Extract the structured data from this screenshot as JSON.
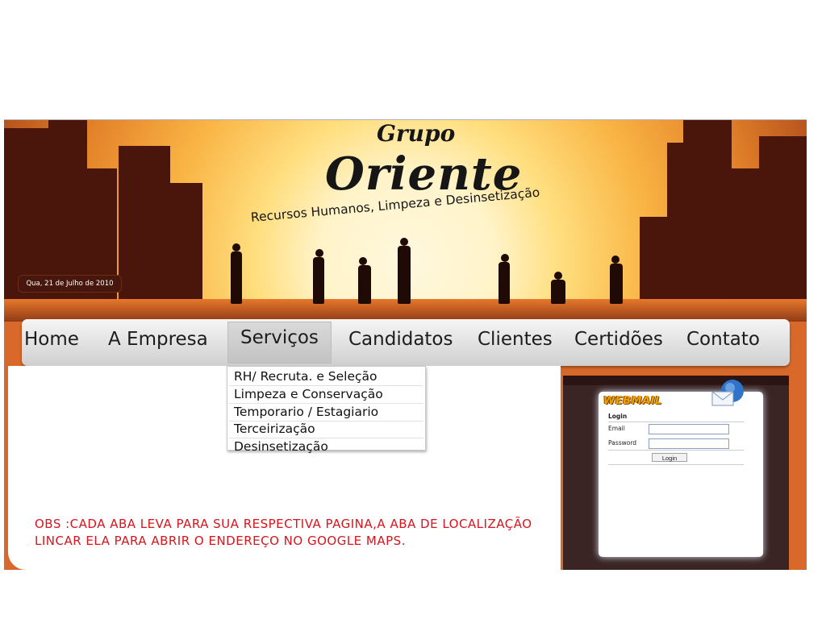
{
  "header": {
    "brand_group": "Grupo",
    "brand_name": "Oriente",
    "tagline": "Recursos Humanos, Limpeza e Desinsetização",
    "date": "Qua, 21 de Julho de 2010"
  },
  "nav": {
    "items": [
      {
        "label": "Home"
      },
      {
        "label": "A Empresa"
      },
      {
        "label": "Serviços"
      },
      {
        "label": "Candidatos"
      },
      {
        "label": "Clientes"
      },
      {
        "label": "Certidões"
      },
      {
        "label": "Contato"
      }
    ],
    "active": "Serviços"
  },
  "dropdown": {
    "items": [
      {
        "label": "RH/ Recruta. e Seleção"
      },
      {
        "label": "Limpeza e Conservação"
      },
      {
        "label": "Temporario / Estagiario"
      },
      {
        "label": "Terceirização"
      },
      {
        "label": "Desinsetização"
      }
    ]
  },
  "note": "OBS :CADA ABA LEVA PARA SUA RESPECTIVA PAGINA,A ABA DE LOCALIZAÇÃO LINCAR ELA PARA ABRIR O ENDEREÇO NO GOOGLE MAPS.",
  "webmail": {
    "logo": "WEBMAIL",
    "login_heading": "Login",
    "email_label": "Email",
    "email_value": "",
    "password_label": "Password",
    "password_value": "",
    "login_button": "Login"
  },
  "colors": {
    "note_text": "#d8141c",
    "site_orange": "#d9692a",
    "silhouette": "#4a160c"
  }
}
